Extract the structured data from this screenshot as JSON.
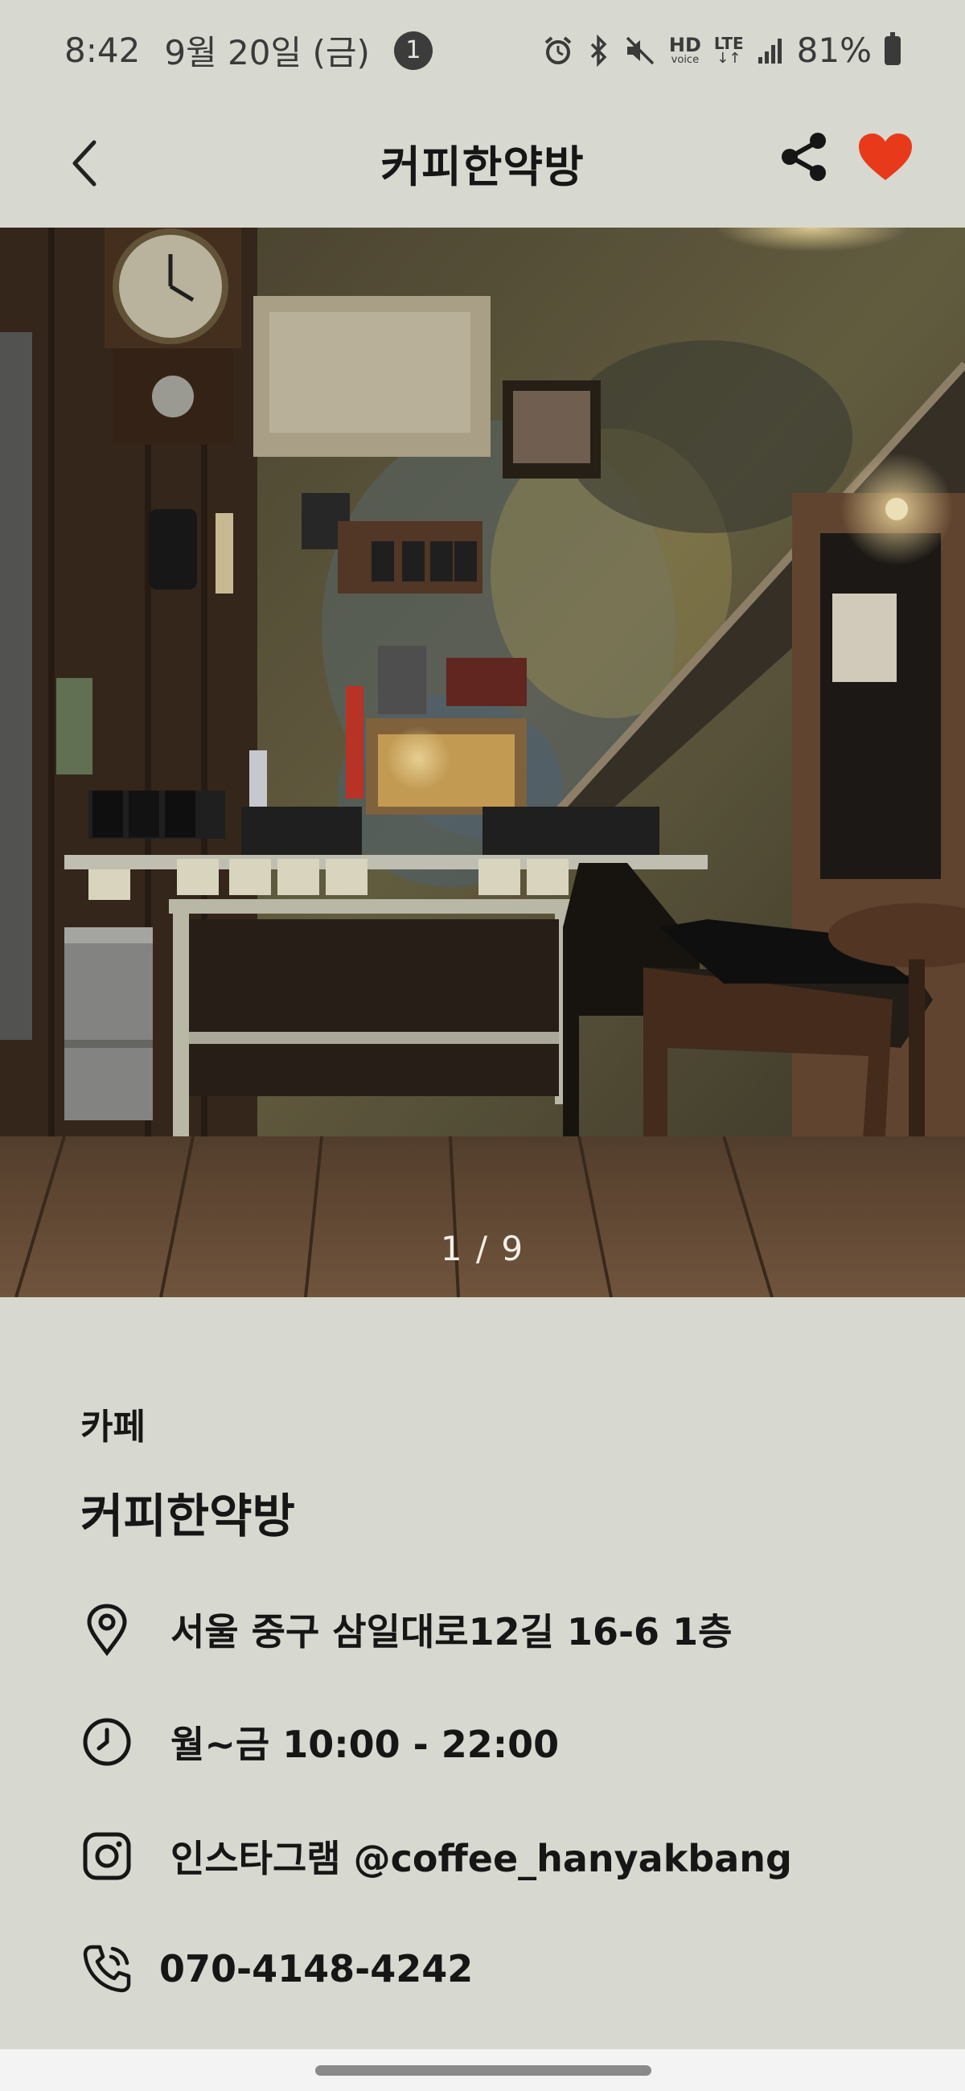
{
  "status_bar": {
    "time": "8:42",
    "date": "9월 20일 (금)",
    "notification_count": "1",
    "battery": "81%",
    "icons": [
      "alarm-icon",
      "bluetooth-icon",
      "mute-icon",
      "hd-voice-icon",
      "lte-icon",
      "signal-icon",
      "battery-icon"
    ],
    "hd_label": "HD",
    "voice_label": "voice",
    "lte_label": "LTE"
  },
  "app_bar": {
    "title": "커피한약방",
    "back_icon": "chevron-left-icon",
    "share_icon": "share-icon",
    "favorite_icon": "heart-icon",
    "favorite_color": "#e8391b"
  },
  "gallery": {
    "counter": "1 / 9"
  },
  "place": {
    "category": "카페",
    "name": "커피한약방",
    "address": "서울 중구 삼일대로12길 16-6 1층",
    "hours": "월~금 10:00 - 22:00",
    "instagram": "인스타그램 @coffee_hanyakbang",
    "phone": "070-4148-4242"
  }
}
